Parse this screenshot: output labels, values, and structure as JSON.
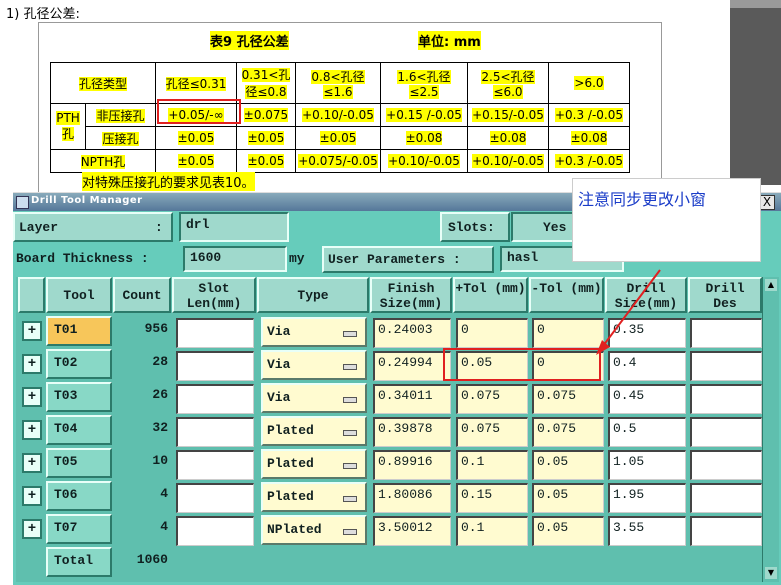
{
  "document": {
    "heading": "1) 孔径公差:",
    "table_caption": "表9  孔径公差",
    "table_unit": "单位: mm",
    "header": [
      "孔径类型",
      "孔径≤0.31",
      "0.31<孔径≤0.8",
      "0.8<孔径≤1.6",
      "1.6<孔径≤2.5",
      "2.5<孔径≤6.0",
      ">6.0"
    ],
    "rows": [
      {
        "group": "PTH孔",
        "label": "非压接孔",
        "values": [
          "+0.05/-∞",
          "±0.075",
          "+0.10/-0.05",
          "+0.15 /-0.05",
          "+0.15/-0.05",
          "+0.3 /-0.05"
        ]
      },
      {
        "group": "",
        "label": "压接孔",
        "values": [
          "±0.05",
          "±0.05",
          "±0.05",
          "±0.08",
          "±0.08",
          "±0.08"
        ]
      },
      {
        "group": "",
        "label": "NPTH孔",
        "values": [
          "±0.05",
          "±0.05",
          "+0.075/-0.05",
          "+0.10/-0.05",
          "+0.10/-0.05",
          "+0.3 /-0.05"
        ]
      }
    ],
    "note": "对特殊压接孔的要求见表10。"
  },
  "window": {
    "title": "Drill Tool Manager",
    "close_label": "X",
    "layer_label": "Layer",
    "layer_colon": ":",
    "layer_value": "drl",
    "slots_label": "Slots:",
    "slots_value": "Yes",
    "board_thickness_label": "Board Thickness :",
    "board_thickness_value": "1600",
    "board_thickness_unit": "my",
    "user_params_label": "User Parameters :",
    "user_params_value": "hasl"
  },
  "grid": {
    "headers": {
      "tool": "Tool",
      "count": "Count",
      "slot": "Slot Len(mm)",
      "type": "Type",
      "finish": "Finish Size(mm)",
      "ptol": "+Tol (mm)",
      "mtol": "-Tol (mm)",
      "drill": "Drill Size(mm)",
      "des": "Drill Des"
    },
    "rows": [
      {
        "expand": "+",
        "tool": "T01",
        "count": "956",
        "type": "Via",
        "finish": "0.24003",
        "ptol": "0",
        "mtol": "0",
        "drill": "0.35"
      },
      {
        "expand": "+",
        "tool": "T02",
        "count": "28",
        "type": "Via",
        "finish": "0.24994",
        "ptol": "0.05",
        "mtol": "0",
        "drill": "0.4"
      },
      {
        "expand": "+",
        "tool": "T03",
        "count": "26",
        "type": "Via",
        "finish": "0.34011",
        "ptol": "0.075",
        "mtol": "0.075",
        "drill": "0.45"
      },
      {
        "expand": "+",
        "tool": "T04",
        "count": "32",
        "type": "Plated",
        "finish": "0.39878",
        "ptol": "0.075",
        "mtol": "0.075",
        "drill": "0.5"
      },
      {
        "expand": "+",
        "tool": "T05",
        "count": "10",
        "type": "Plated",
        "finish": "0.89916",
        "ptol": "0.1",
        "mtol": "0.05",
        "drill": "1.05"
      },
      {
        "expand": "+",
        "tool": "T06",
        "count": "4",
        "type": "Plated",
        "finish": "1.80086",
        "ptol": "0.15",
        "mtol": "0.05",
        "drill": "1.95"
      },
      {
        "expand": "+",
        "tool": "T07",
        "count": "4",
        "type": "NPlated",
        "finish": "3.50012",
        "ptol": "0.1",
        "mtol": "0.05",
        "drill": "3.55"
      }
    ],
    "total_label": "Total",
    "total_value": "1060"
  },
  "annotation": {
    "text": "注意同步更改小窗"
  },
  "colors": {
    "window_bg": "#66ccbb",
    "selected_tool": "#f7c65a",
    "annotation_red": "#e02020",
    "annotation_blue": "#1a3cc8",
    "highlight": "#ffff00"
  }
}
